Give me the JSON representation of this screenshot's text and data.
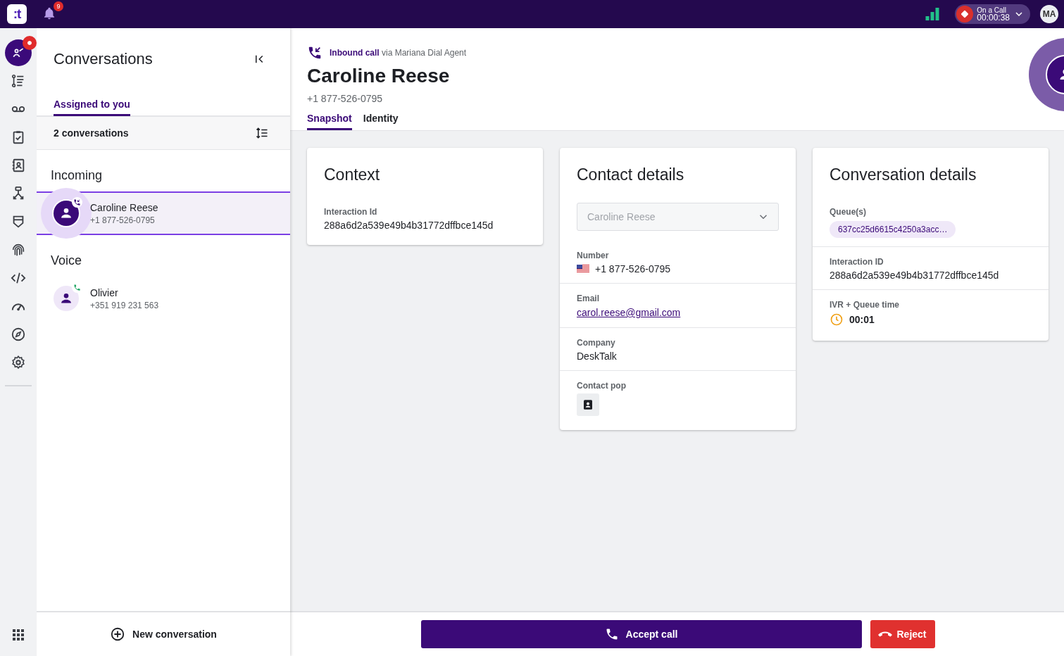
{
  "topbar": {
    "logo": ":t",
    "notifications": "9",
    "call_status": {
      "label": "On a Call",
      "timer": "00:00:38"
    },
    "user_initials": "MA"
  },
  "rail": [
    {
      "kind": "agent",
      "selected": true,
      "badge": true
    },
    {
      "kind": "list",
      "selected": false,
      "badge": false
    },
    {
      "kind": "voicemail",
      "selected": false,
      "badge": false
    },
    {
      "kind": "clipboard",
      "selected": false,
      "badge": false
    },
    {
      "kind": "contacts",
      "selected": false,
      "badge": false
    },
    {
      "kind": "flow",
      "selected": false,
      "badge": false
    },
    {
      "kind": "shield",
      "selected": false,
      "badge": false
    },
    {
      "kind": "fingerprint",
      "selected": false,
      "badge": false
    },
    {
      "kind": "code",
      "selected": false,
      "badge": false
    },
    {
      "kind": "gauge",
      "selected": false,
      "badge": false
    },
    {
      "kind": "compass",
      "selected": false,
      "badge": false
    },
    {
      "kind": "settings",
      "selected": false,
      "badge": false
    }
  ],
  "conversations": {
    "title": "Conversations",
    "tabs": [
      {
        "label": "Assigned to you",
        "selected": true
      }
    ],
    "count": "2 conversations",
    "groups": [
      {
        "title": "Incoming",
        "items": [
          {
            "name": "Caroline Reese",
            "phone": "+1 877-526-0795",
            "selected": true,
            "kind": "inbound"
          }
        ]
      },
      {
        "title": "Voice",
        "items": [
          {
            "name": "Olivier",
            "phone": "+351 919 231 563",
            "selected": false,
            "kind": "active"
          }
        ]
      }
    ],
    "new_button": "New conversation"
  },
  "call": {
    "direction": "Inbound call",
    "via": "via Mariana Dial Agent",
    "name": "Caroline Reese",
    "phone": "+1 877-526-0795",
    "tabs": [
      {
        "label": "Snapshot",
        "selected": true
      },
      {
        "label": "Identity",
        "selected": false
      }
    ]
  },
  "cards": [
    {
      "title": "Context",
      "fields": [
        {
          "kind": "text",
          "label": "Interaction Id",
          "value": "288a6d2a539e49b4b31772dffbce145d"
        }
      ]
    },
    {
      "title": "Contact details",
      "select": {
        "value": "Caroline Reese",
        "disabled": true
      },
      "fields": [
        {
          "kind": "phone",
          "label": "Number",
          "value": "+1 877-526-0795"
        },
        {
          "kind": "link",
          "label": "Email",
          "value": "carol.reese@gmail.com"
        },
        {
          "kind": "text",
          "label": "Company",
          "value": "DeskTalk"
        },
        {
          "kind": "button",
          "label": "Contact pop"
        }
      ]
    },
    {
      "title": "Conversation details",
      "fields": [
        {
          "kind": "chip",
          "label": "Queue(s)",
          "value": "637cc25d6615c4250a3acc…"
        },
        {
          "kind": "text",
          "label": "Interaction ID",
          "value": "288a6d2a539e49b4b31772dffbce145d"
        },
        {
          "kind": "timer",
          "label": "IVR + Queue time",
          "value": "00:01"
        }
      ]
    }
  ],
  "actions": {
    "accept": "Accept call",
    "reject": "Reject"
  }
}
